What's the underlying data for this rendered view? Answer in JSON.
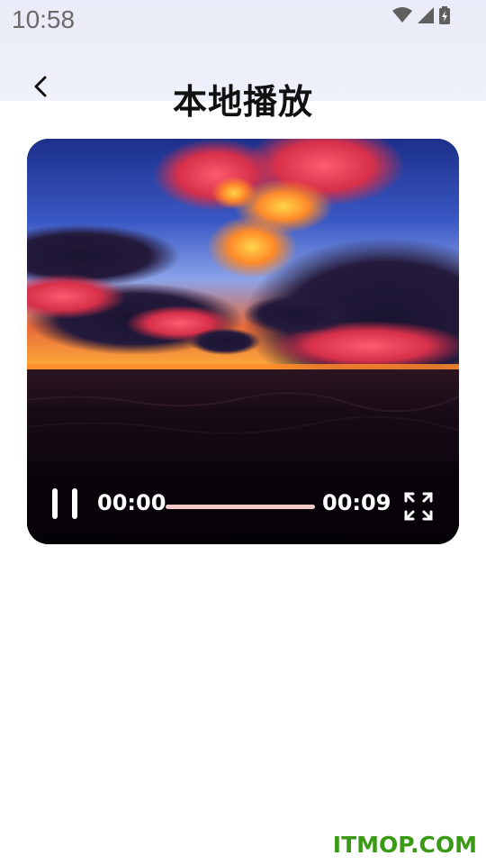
{
  "status_bar": {
    "time": "10:58",
    "icons": [
      "wifi-icon",
      "cellular-signal-icon",
      "battery-charging-icon"
    ]
  },
  "header": {
    "back_icon": "chevron-left-icon",
    "title": "本地播放"
  },
  "player": {
    "scene": "sunset-over-ocean-video-frame",
    "controls": {
      "pause_icon": "pause-icon",
      "current_time": "00:00",
      "total_time": "00:09",
      "progress": 0,
      "fullscreen_icon": "fullscreen-icon"
    }
  },
  "watermark": {
    "text": "ITMOP.COM",
    "color": "#3a9a16"
  },
  "colors": {
    "top_band": "#eceff9",
    "progress_track": "#f2c9c6",
    "title": "#111111"
  }
}
